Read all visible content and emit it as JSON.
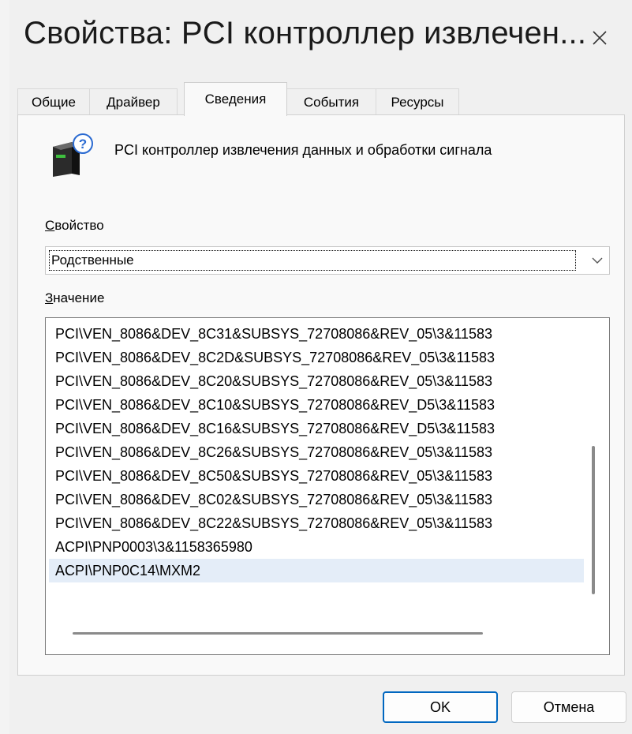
{
  "window": {
    "title": "Свойства: PCI контроллер извлечен..."
  },
  "tabs": [
    {
      "label": "Общие"
    },
    {
      "label": "Драйвер"
    },
    {
      "label": "Сведения"
    },
    {
      "label": "События"
    },
    {
      "label": "Ресурсы"
    }
  ],
  "active_tab": "Сведения",
  "device": {
    "icon": "unknown-device-icon",
    "name": "PCI контроллер извлечения данных и обработки сигнала"
  },
  "property": {
    "label_accel": "С",
    "label_rest": "войство",
    "selected": "Родственные"
  },
  "value": {
    "label_accel": "З",
    "label_rest": "начение",
    "items": [
      "PCI\\VEN_8086&DEV_8C31&SUBSYS_72708086&REV_05\\3&11583",
      "PCI\\VEN_8086&DEV_8C2D&SUBSYS_72708086&REV_05\\3&11583",
      "PCI\\VEN_8086&DEV_8C20&SUBSYS_72708086&REV_05\\3&11583",
      "PCI\\VEN_8086&DEV_8C10&SUBSYS_72708086&REV_D5\\3&11583",
      "PCI\\VEN_8086&DEV_8C16&SUBSYS_72708086&REV_D5\\3&11583",
      "PCI\\VEN_8086&DEV_8C26&SUBSYS_72708086&REV_05\\3&11583",
      "PCI\\VEN_8086&DEV_8C50&SUBSYS_72708086&REV_05\\3&11583",
      "PCI\\VEN_8086&DEV_8C02&SUBSYS_72708086&REV_05\\3&11583",
      "PCI\\VEN_8086&DEV_8C22&SUBSYS_72708086&REV_05\\3&11583",
      "ACPI\\PNP0003\\3&1158365980",
      "ACPI\\PNP0C14\\MXM2"
    ],
    "selected_index": 10
  },
  "buttons": {
    "ok": "OK",
    "cancel": "Отмена"
  },
  "colors": {
    "accent": "#0067c0",
    "selection": "#e4edf8",
    "window_bg": "#f0f0f0"
  }
}
